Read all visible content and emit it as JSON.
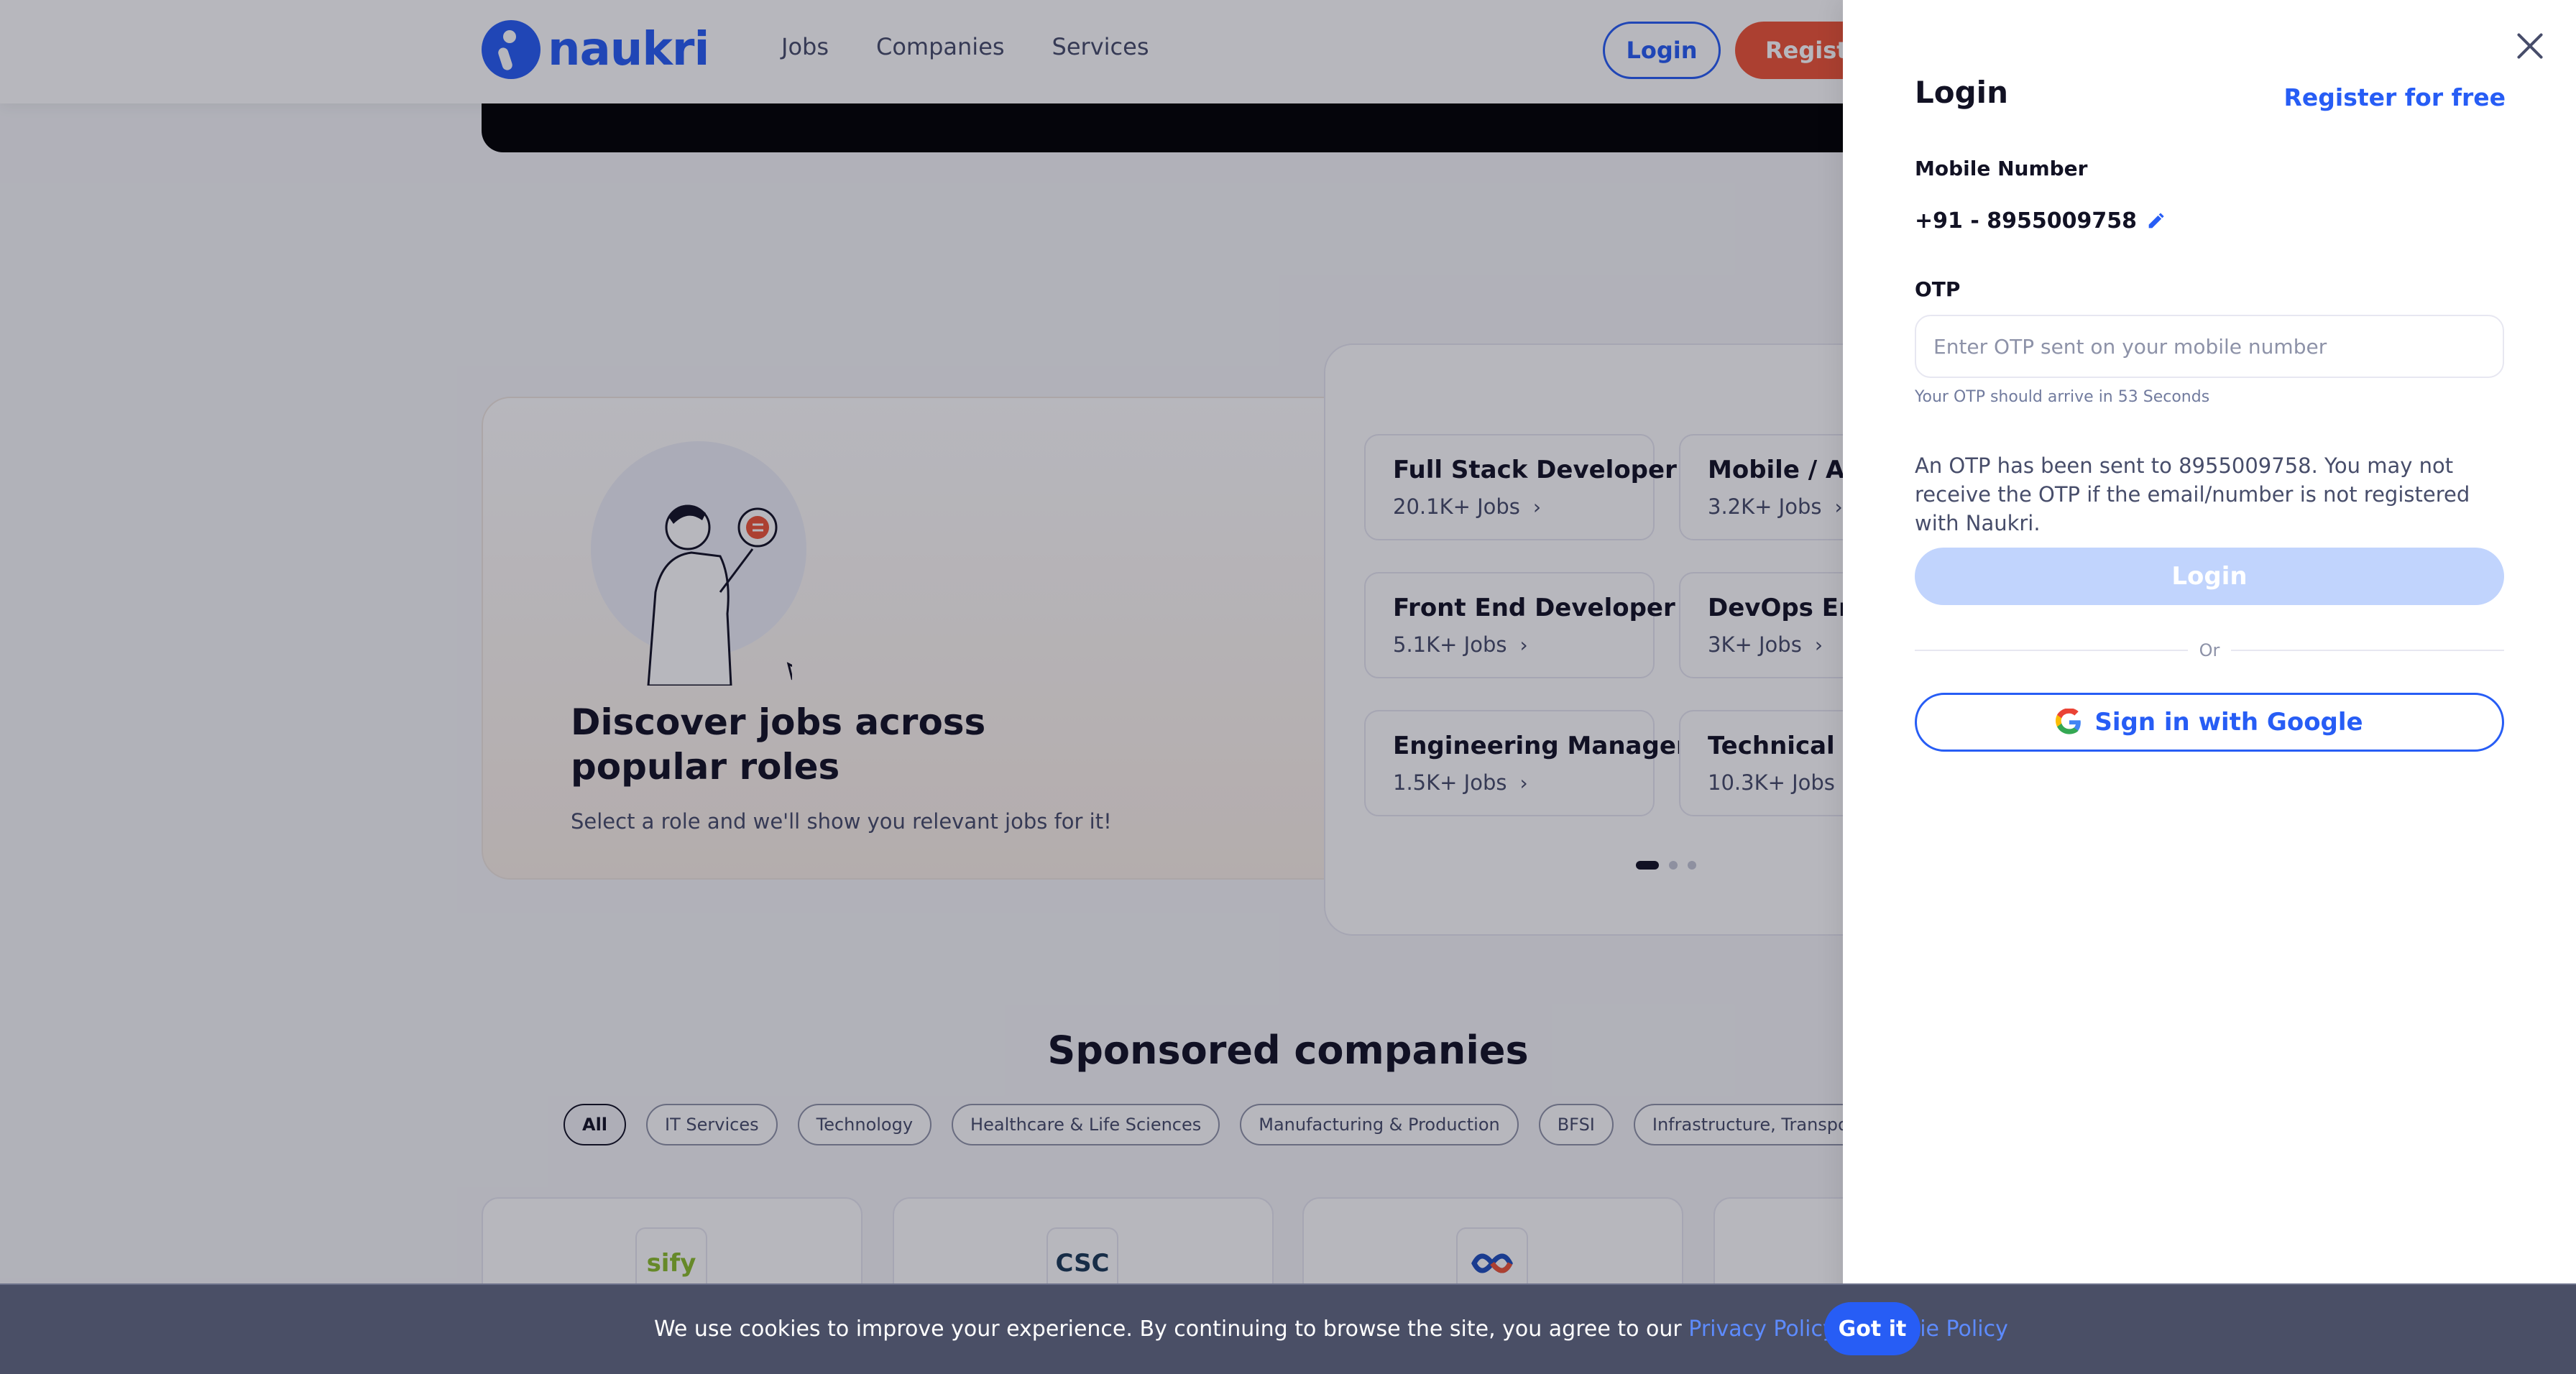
{
  "nav": {
    "logo_text": "naukri",
    "links": [
      "Jobs",
      "Companies",
      "Services"
    ],
    "login_label": "Login",
    "register_label": "Registe"
  },
  "discover": {
    "title": "Discover jobs across popular roles",
    "subtitle": "Select a role and we'll show you relevant jobs for it!"
  },
  "roles": [
    {
      "title": "Full Stack Developer",
      "count": "20.1K+ Jobs"
    },
    {
      "title": "Mobile / App",
      "count": "3.2K+ Jobs"
    },
    {
      "title": "Front End Developer",
      "count": "5.1K+ Jobs"
    },
    {
      "title": "DevOps Engi",
      "count": "3K+ Jobs"
    },
    {
      "title": "Engineering Manager",
      "count": "1.5K+ Jobs"
    },
    {
      "title": "Technical Lea",
      "count": "10.3K+ Jobs"
    }
  ],
  "sponsored": {
    "title": "Sponsored companies",
    "chips": [
      "All",
      "IT Services",
      "Technology",
      "Healthcare & Life Sciences",
      "Manufacturing & Production",
      "BFSI",
      "Infrastructure, Transport & Real Es"
    ],
    "company_logos": [
      "sify",
      "CSC",
      ""
    ]
  },
  "login_drawer": {
    "title": "Login",
    "register_link": "Register for free",
    "mobile_label": "Mobile Number",
    "mobile_value": "+91 - 8955009758",
    "otp_label": "OTP",
    "otp_placeholder": "Enter OTP sent on your mobile number",
    "otp_timer": "Your OTP should arrive in 53 Seconds",
    "otp_note": "An OTP has been sent to 8955009758. You may not receive the OTP if the email/number is not registered with Naukri.",
    "login_button": "Login",
    "or_text": "Or",
    "google_button": "Sign in with Google"
  },
  "cookie": {
    "text_before": "We use cookies to improve your experience. By continuing to browse the site, you agree to our ",
    "privacy_link": "Privacy Policy",
    "amp": " & ",
    "cookie_link": "Cookie Policy",
    "button": "Got it"
  },
  "colors": {
    "brand_blue": "#275df5",
    "register_orange": "#f05537",
    "disabled_button": "#c1d4fd",
    "cookie_bar": "#4a4f66"
  }
}
